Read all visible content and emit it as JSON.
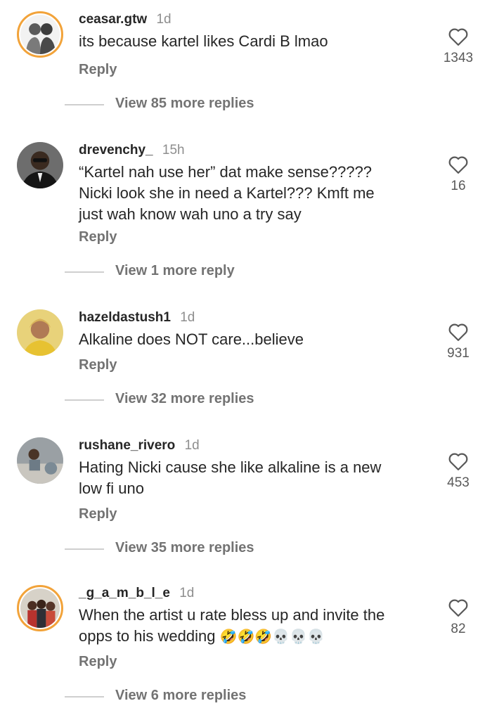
{
  "comments": [
    {
      "username": "ceasar.gtw",
      "time": "1d",
      "text_lines": [
        "its because kartel likes Cardi B lmao"
      ],
      "emoji": "",
      "reply_label": "Reply",
      "view_replies": "View 85 more replies",
      "likes": "1343"
    },
    {
      "username": "drevenchy_",
      "time": "15h",
      "text_lines": [
        "“Kartel nah use her” dat make sense?????",
        "Nicki look she in need a Kartel??? Kmft me",
        "just wah know wah uno a try say"
      ],
      "emoji": "",
      "reply_label": "Reply",
      "view_replies": "View 1 more reply",
      "likes": "16"
    },
    {
      "username": "hazeldastush1",
      "time": "1d",
      "text_lines": [
        "Alkaline does NOT care...believe"
      ],
      "emoji": "",
      "reply_label": "Reply",
      "view_replies": "View 32 more replies",
      "likes": "931"
    },
    {
      "username": "rushane_rivero",
      "time": "1d",
      "text_lines": [
        "Hating Nicki cause she like alkaline is a new",
        "low fi uno"
      ],
      "emoji": "",
      "reply_label": "Reply",
      "view_replies": "View 35 more replies",
      "likes": "453"
    },
    {
      "username": "_g_a_m_b_l_e",
      "time": "1d",
      "text_lines": [
        "When the artist u rate bless up and invite the",
        "opps to his wedding"
      ],
      "emoji": "🤣🤣🤣💀💀💀",
      "reply_label": "Reply",
      "view_replies": "View 6 more replies",
      "likes": "82"
    }
  ],
  "icons": {
    "like": "heart-outline-icon"
  },
  "colors": {
    "text": "#262626",
    "secondary": "#737373",
    "story_ring": "#f2a33a"
  }
}
